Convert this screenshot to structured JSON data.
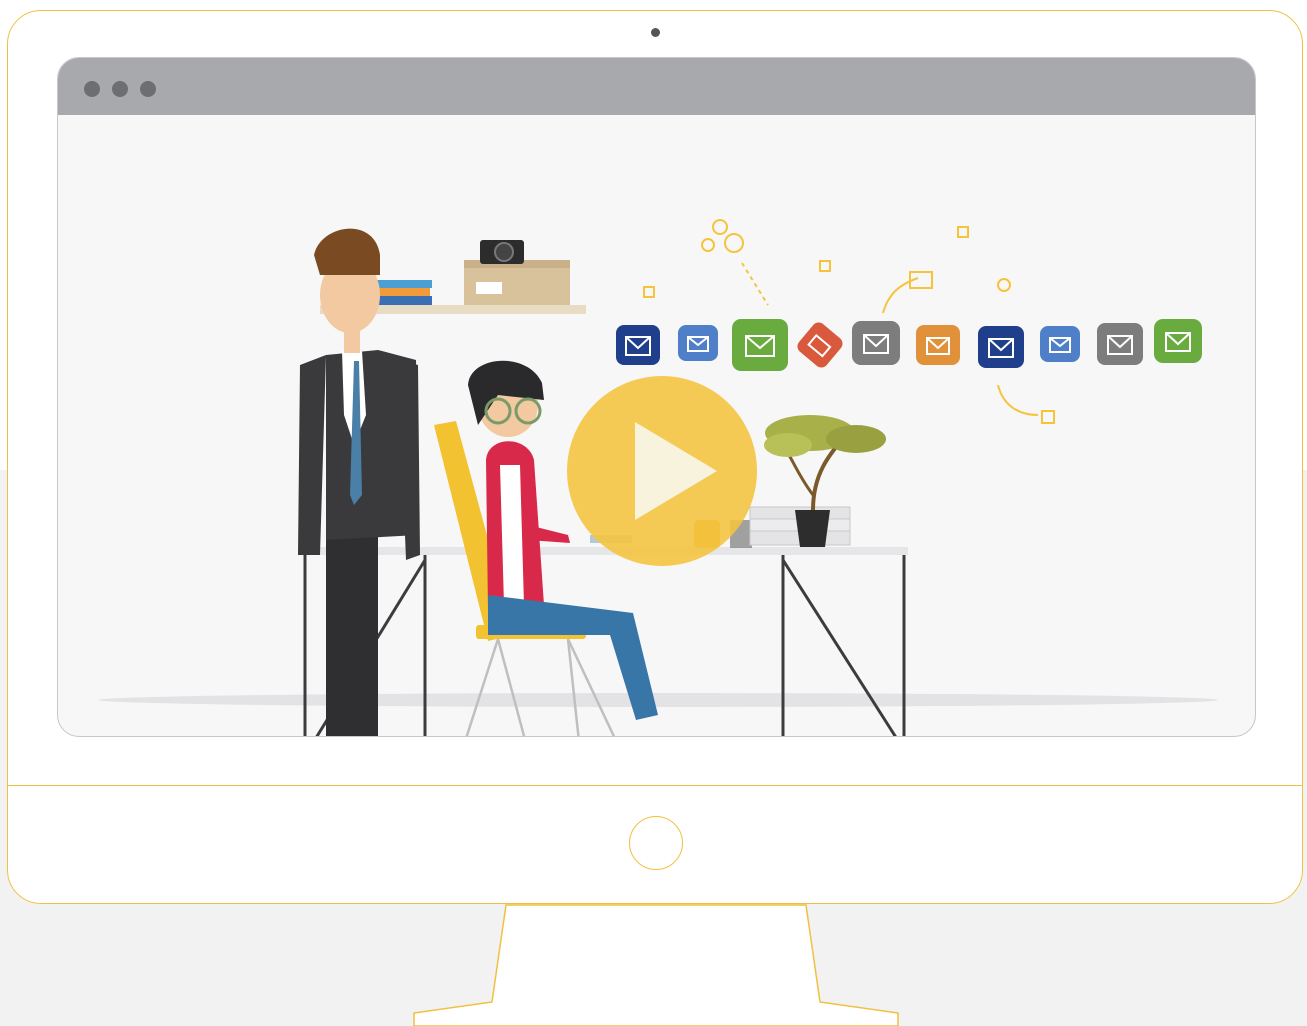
{
  "window": {
    "title": "",
    "controls": [
      "window-dot",
      "window-dot",
      "window-dot"
    ]
  },
  "video": {
    "state": "paused",
    "scene": {
      "mail_bubble_colors": [
        "#1f3f8c",
        "#4f7fc8",
        "#6aab3f",
        "#d9593c",
        "#7d7d7d",
        "#e0913a",
        "#1f3f8c",
        "#4f7fc8",
        "#7d7d7d",
        "#6aab3f"
      ],
      "accent_color": "#f5c43c"
    },
    "play_icon": "play-icon"
  },
  "colors": {
    "frame_outline": "#f0c040",
    "browser_bar": "#a8a9ac",
    "window_dot": "#6d6e71"
  }
}
